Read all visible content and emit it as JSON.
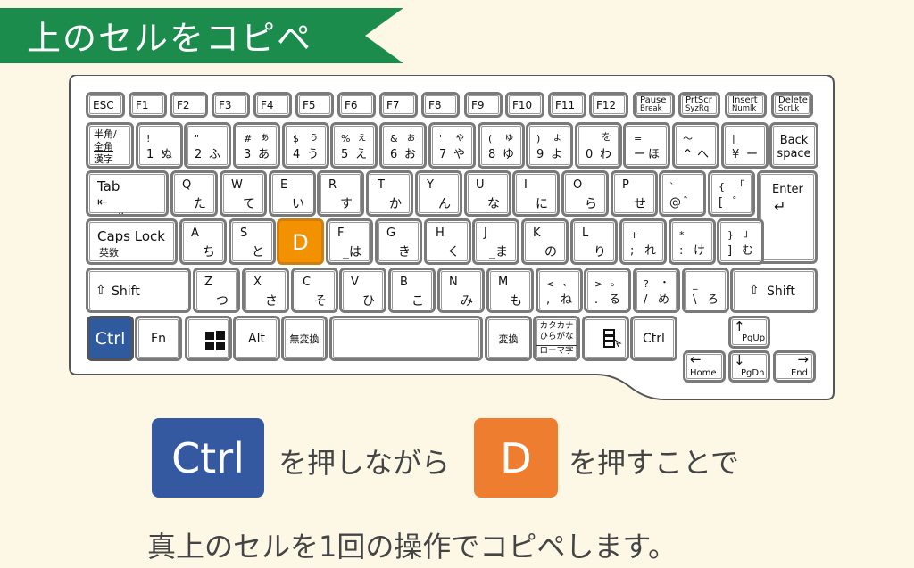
{
  "banner": {
    "title": "上のセルをコピペ",
    "color": "#1c8c4c"
  },
  "keyboard": {
    "function_row": [
      "ESC",
      "F1",
      "F2",
      "F3",
      "F4",
      "F5",
      "F6",
      "F7",
      "F8",
      "F9",
      "F10",
      "F11",
      "F12"
    ],
    "function_row_two_line": [
      {
        "top": "Pause",
        "bottom": "Break"
      },
      {
        "top": "PrtScr",
        "bottom": "SyzRq"
      },
      {
        "top": "Insert",
        "bottom": "Numlk"
      },
      {
        "top": "Delete",
        "bottom": "ScrLk"
      }
    ],
    "hankaku": {
      "line1": "半角/",
      "line2": "全角",
      "line3": "漢字"
    },
    "number_row": [
      {
        "tl": "!",
        "tr": "",
        "bl": "1",
        "br": "ぬ"
      },
      {
        "tl": "\"",
        "tr": "",
        "bl": "2",
        "br": "ふ"
      },
      {
        "tl": "#",
        "tr": "ぁ",
        "bl": "3",
        "br": "あ"
      },
      {
        "tl": "$",
        "tr": "ぅ",
        "bl": "4",
        "br": "う"
      },
      {
        "tl": "%",
        "tr": "ぇ",
        "bl": "5",
        "br": "え"
      },
      {
        "tl": "&",
        "tr": "ぉ",
        "bl": "6",
        "br": "お"
      },
      {
        "tl": "'",
        "tr": "ゃ",
        "bl": "7",
        "br": "や"
      },
      {
        "tl": "(",
        "tr": "ゅ",
        "bl": "8",
        "br": "ゆ"
      },
      {
        "tl": ")",
        "tr": "ょ",
        "bl": "9",
        "br": "よ"
      },
      {
        "tl": "",
        "tr": "を",
        "bl": "0",
        "br": "わ"
      },
      {
        "tl": "=",
        "tr": "",
        "bl": "ー",
        "br": "ほ"
      },
      {
        "tl": "～",
        "tr": "",
        "bl": "^",
        "br": "へ"
      },
      {
        "tl": "|",
        "tr": "",
        "bl": "¥",
        "br": "ー"
      }
    ],
    "backspace": {
      "line1": "Back",
      "line2": "space"
    },
    "tab": "Tab",
    "q_row": [
      {
        "tl": "Q",
        "br": "た"
      },
      {
        "tl": "W",
        "br": "て"
      },
      {
        "tl": "E",
        "br": "い"
      },
      {
        "tl": "R",
        "br": "す"
      },
      {
        "tl": "T",
        "br": "か"
      },
      {
        "tl": "Y",
        "br": "ん"
      },
      {
        "tl": "U",
        "br": "な"
      },
      {
        "tl": "I",
        "br": "に"
      },
      {
        "tl": "O",
        "br": "ら"
      },
      {
        "tl": "P",
        "br": "せ"
      }
    ],
    "q_row_extra": [
      {
        "tl": "`",
        "tr": "",
        "bl": "@",
        "br": "゛"
      },
      {
        "tl": "{",
        "tr": "「",
        "bl": "[",
        "br": "゜"
      }
    ],
    "enter": "Enter",
    "caps": {
      "line1": "Caps Lock",
      "line2": "英数"
    },
    "a_row": [
      {
        "tl": "A",
        "br": "ち"
      },
      {
        "tl": "S",
        "br": "と"
      },
      {
        "tl": "D",
        "br": "",
        "highlight": true
      },
      {
        "tl": "F",
        "br": "_は"
      },
      {
        "tl": "G",
        "br": "き"
      },
      {
        "tl": "H",
        "br": "く"
      },
      {
        "tl": "J",
        "br": "_ま"
      },
      {
        "tl": "K",
        "br": "の"
      },
      {
        "tl": "L",
        "br": "り"
      }
    ],
    "a_row_extra": [
      {
        "tl": "+",
        "tr": "",
        "bl": ";",
        "br": "れ"
      },
      {
        "tl": "*",
        "tr": "",
        "bl": ":",
        "br": "け"
      },
      {
        "tl": "}",
        "tr": "」",
        "bl": "]",
        "br": "む"
      }
    ],
    "shift": "Shift",
    "z_row": [
      {
        "tl": "Z",
        "br": "つ"
      },
      {
        "tl": "X",
        "br": "さ"
      },
      {
        "tl": "C",
        "br": "そ"
      },
      {
        "tl": "V",
        "br": "ひ"
      },
      {
        "tl": "B",
        "br": "こ"
      },
      {
        "tl": "N",
        "br": "み"
      },
      {
        "tl": "M",
        "br": "も"
      }
    ],
    "z_row_extra": [
      {
        "tl": "<",
        "tr": "、",
        "bl": ",",
        "br": "ね"
      },
      {
        "tl": ">",
        "tr": "。",
        "bl": ".",
        "br": "る"
      },
      {
        "tl": "?",
        "tr": "・",
        "bl": "/",
        "br": "め"
      },
      {
        "tl": "_",
        "tr": "",
        "bl": "\\",
        "br": "ろ"
      }
    ],
    "bottom_row": {
      "ctrl_left": "Ctrl",
      "fn": "Fn",
      "alt": "Alt",
      "muhenkan": "無変換",
      "henkan": "変換",
      "kana": {
        "line1": "カタカナ",
        "line2": "ひらがな",
        "line3": "ローマ字"
      },
      "ctrl_right": "Ctrl"
    },
    "nav": {
      "pgup": "PgUp",
      "pgdn": "PgDn",
      "home": "Home",
      "end": "End"
    },
    "highlight_colors": {
      "ctrl": "#2f5a9e",
      "d": "#f39200"
    }
  },
  "instruction": {
    "ctrl_label": "Ctrl",
    "text1": "を押しながら",
    "d_label": "D",
    "text2": "を押すことで",
    "line2": "真上のセルを1回の操作でコピペします。"
  }
}
